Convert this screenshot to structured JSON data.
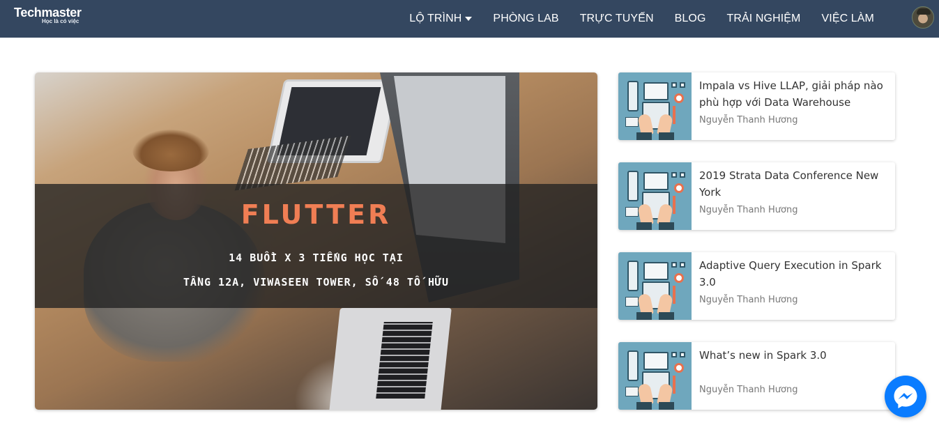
{
  "header": {
    "logo_text": "Techmaster",
    "logo_tagline": "Học là có việc",
    "nav": [
      {
        "label": "LỘ TRÌNH",
        "has_dropdown": true
      },
      {
        "label": "PHÒNG LAB"
      },
      {
        "label": "TRỰC TUYẾN"
      },
      {
        "label": "BLOG"
      },
      {
        "label": "TRẢI NGHIỆM"
      },
      {
        "label": "VIỆC LÀM"
      }
    ],
    "avatar_icon": "user-avatar"
  },
  "hero": {
    "title": "FLUTTER",
    "line1": "14 BUỔI X 3 TIẾNG HỌC TẠI",
    "line2": "TẦNG 12A, VIWASEEN TOWER, SỐ 48 TỐ HỮU",
    "title_color": "#f07e54"
  },
  "posts": [
    {
      "title": "Impala vs Hive LLAP, giải pháp nào phù hợp với Data Warehouse",
      "author": "Nguyễn Thanh Hương"
    },
    {
      "title": "2019 Strata Data Conference New York",
      "author": "Nguyễn Thanh Hương"
    },
    {
      "title": "Adaptive Query Execution in Spark 3.0",
      "author": "Nguyễn Thanh Hương"
    },
    {
      "title": "What’s new in Spark 3.0",
      "author": "Nguyễn Thanh Hương"
    }
  ],
  "colors": {
    "navbar": "#344760",
    "messenger": "#0a7cff"
  },
  "chat_icon": "messenger-icon"
}
